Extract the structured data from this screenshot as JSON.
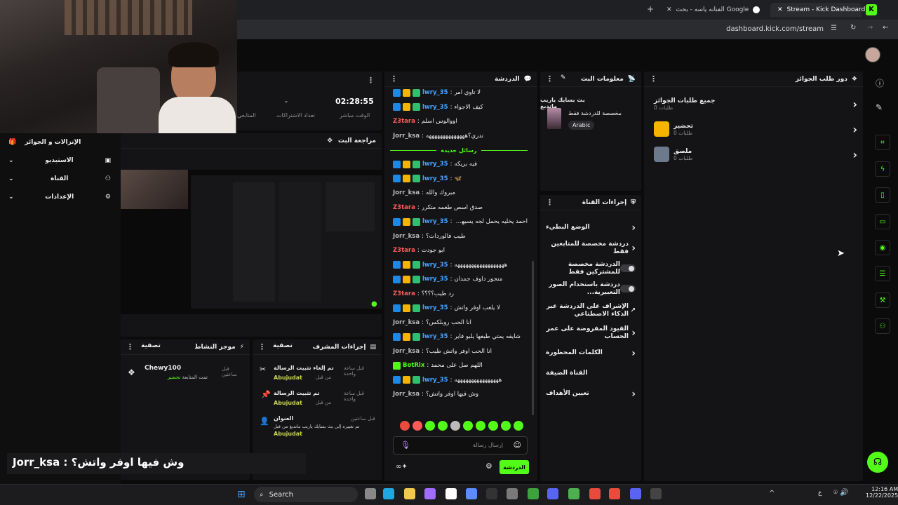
{
  "browser": {
    "tabs": [
      {
        "label": "Stream - Kick Dashboard",
        "active": true
      },
      {
        "label": "الفنانه ياسه - بحث Google",
        "active": false
      }
    ],
    "url": "dashboard.kick.com/stream"
  },
  "stats": {
    "uptime_value": "02:28:55",
    "uptime_label": "الوقت مباشر",
    "subs_value": "-",
    "subs_label": "تعداد الاشتراكات",
    "followers_label": "المتابعي"
  },
  "left_nav": {
    "title": "الإنزالات و الجوائز",
    "items": [
      "الاستيديو",
      "القناة",
      "الإعدادات"
    ]
  },
  "preview": {
    "title": "مراجعة البث"
  },
  "activity": {
    "title": "موجز النشاط",
    "filter": "تصفية",
    "item_user": "Chewy100",
    "item_text": "تمت المتابعة",
    "item_action": "تحضير",
    "item_time": "قبل ساعتين"
  },
  "mod_actions": {
    "title": "إجراءات المشرف",
    "filter": "تصفية",
    "items": [
      {
        "title": "تم إلغاء تثبيت الرسالة",
        "by": "من قبل",
        "user": "Abujudat",
        "time": "قبل ساعة واحدة"
      },
      {
        "title": "تم تثبيت الرسالة",
        "by": "من قبل",
        "user": "Abujudat",
        "time": "قبل ساعة واحدة"
      },
      {
        "title": "العنوان",
        "by": "تم تغييره إلى بث بسايك ياريب ماتدبغ من قبل",
        "user": "Abujudat",
        "time": "قبل ساعتين"
      }
    ]
  },
  "chat": {
    "title": "الدردشة",
    "new_messages": "رسائل جديدة",
    "messages": [
      {
        "user": "lwry_35",
        "text": "لا تاوي امر",
        "color": "#4aa3ff",
        "badges": 3
      },
      {
        "user": "lwry_35",
        "text": "كيف الاجواء",
        "color": "#4aa3ff",
        "badges": 3
      },
      {
        "user": "Z3tara",
        "text": "اووالوس اسلم",
        "color": "#ff5a5a",
        "badges": 0
      },
      {
        "user": "Jorr_ksa",
        "text": "تدري؟ههههههههههههههه",
        "color": "#b9b9b9",
        "badges": 0
      },
      {
        "user": "lwry_35",
        "text": "فيه بريكه",
        "color": "#4aa3ff",
        "badges": 3
      },
      {
        "user": "lwry_35",
        "text": "🦋",
        "color": "#4aa3ff",
        "badges": 3
      },
      {
        "user": "Jorr_ksa",
        "text": "مبروك والله",
        "color": "#b9b9b9",
        "badges": 0
      },
      {
        "user": "Z3tara",
        "text": "صدق اسص طعمه متكرر",
        "color": "#ff5a5a",
        "badges": 0
      },
      {
        "user": "lwry_35",
        "text": "احمد يخليه يحمل لجه يسيها ويخفيها",
        "color": "#4aa3ff",
        "badges": 3
      },
      {
        "user": "Jorr_ksa",
        "text": "طيب فالوردات؟",
        "color": "#b9b9b9",
        "badges": 0
      },
      {
        "user": "Z3tara",
        "text": "ابو جودت",
        "color": "#ff5a5a",
        "badges": 0
      },
      {
        "user": "lwry_35",
        "text": "ههههههههههههههههههه",
        "color": "#4aa3ff",
        "badges": 3
      },
      {
        "user": "lwry_35",
        "text": "متجور داوف جمدان",
        "color": "#4aa3ff",
        "badges": 3
      },
      {
        "user": "Z3tara",
        "text": "رد طيب؟؟؟؟",
        "color": "#ff5a5a",
        "badges": 0
      },
      {
        "user": "lwry_35",
        "text": "لا يلعب اوفر واتش",
        "color": "#4aa3ff",
        "badges": 3
      },
      {
        "user": "Jorr_ksa",
        "text": "انا الحب روبلكس؟",
        "color": "#b9b9b9",
        "badges": 0
      },
      {
        "user": "lwry_35",
        "text": "شايفه يمتي طبعها يلبو فاير",
        "color": "#4aa3ff",
        "badges": 3
      },
      {
        "user": "Jorr_ksa",
        "text": "انا الحب اوفر واتش طيب؟",
        "color": "#b9b9b9",
        "badges": 0
      },
      {
        "user": "BotRix",
        "text": "اللهم صل على محمد",
        "color": "#53fc18",
        "badges": 1
      },
      {
        "user": "lwry_35",
        "text": "ههههههههههههههههه",
        "color": "#4aa3ff",
        "badges": 3
      },
      {
        "user": "Jorr_ksa",
        "text": "وش فيها اوفر واتش؟",
        "color": "#b9b9b9",
        "badges": 0
      }
    ],
    "input_placeholder": "إرسال رسالة",
    "send_button": "الدردشة"
  },
  "stream_info": {
    "title": "معلومات البث",
    "stream_title": "بث بسايك ياريب ماتدبغ",
    "category": "مخصصة للدردشة فقط",
    "language": "Arabic"
  },
  "channel_actions": {
    "title": "إجراءات القناة",
    "items": [
      {
        "label": "الوضع البطيء",
        "control": "chevron"
      },
      {
        "label": "دردشة مخصصة للمتابعين فقط",
        "control": "chevron"
      },
      {
        "label": "الدردشة مخصصة للمشتركين فقط",
        "control": "toggle"
      },
      {
        "label": "دردشة باستخدام الصور التعبيرية...",
        "control": "toggle"
      },
      {
        "label": "الإشراف على الدردشة عبر الذكاء الاصطناعي",
        "control": "external"
      },
      {
        "label": "القيود المفروضة على عمر الحساب",
        "control": "chevron"
      },
      {
        "label": "الكلمات المحظورة",
        "control": "chevron"
      },
      {
        "label": "القناة الضيفة",
        "control": "none"
      },
      {
        "label": "تعيين الأهداف",
        "control": "chevron"
      }
    ]
  },
  "rewards": {
    "title": "دور طلب الجوائز",
    "items": [
      {
        "label": "جميع طلبات الجوائز",
        "sub": "طلبات 0"
      },
      {
        "label": "تحضير",
        "sub": "طلبات 0"
      },
      {
        "label": "ملصق",
        "sub": "طلبات 0"
      }
    ]
  },
  "overlay_caption": "Jorr_ksa : وش فيها اوفر واتش؟",
  "taskbar": {
    "search": "Search",
    "time": "12:16 AM",
    "date": "12/22/2025",
    "lang": "ع"
  },
  "colors": {
    "accent": "#53fc18",
    "bg": "#0b0b0c",
    "panel": "#141416"
  }
}
